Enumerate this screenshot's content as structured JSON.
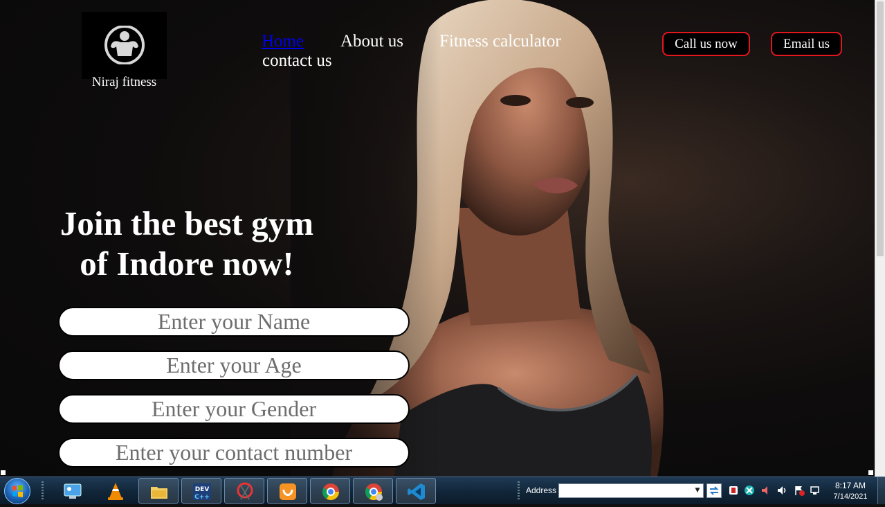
{
  "site": {
    "brand_name": "Niraj fitness",
    "logo_icon": "bodybuilder-icon",
    "nav": {
      "home": "Home",
      "about": "About us",
      "calculator": "Fitness calculator",
      "contact": "contact us"
    },
    "buttons": {
      "call": "Call us now",
      "email": "Email us"
    },
    "headline": {
      "line1": "Join the best gym",
      "line2": "of Indore now!"
    },
    "form": {
      "name_placeholder": "Enter your Name",
      "age_placeholder": "Enter your Age",
      "gender_placeholder": "Enter your Gender",
      "contact_placeholder": "Enter your contact number"
    },
    "colors": {
      "button_border": "#e2171d",
      "active_link": "#0000ee"
    }
  },
  "taskbar": {
    "address_label": "Address",
    "address_value": "",
    "items": [
      "start-orb",
      "control-panel-icon",
      "vlc-icon",
      "file-explorer-icon",
      "devcpp-icon",
      "snipping-tool-icon",
      "uc-browser-icon",
      "chrome-icon",
      "chrome-profile-icon",
      "vscode-icon"
    ],
    "clock": {
      "time": "8:17 AM",
      "date": "7/14/2021"
    }
  }
}
